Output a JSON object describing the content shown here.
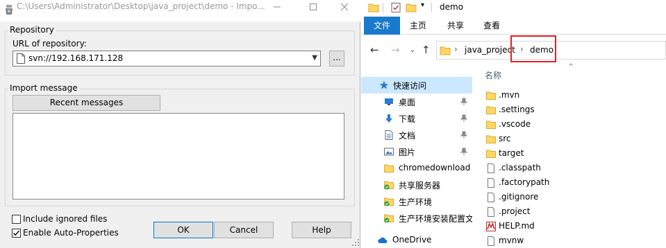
{
  "dialog": {
    "title": "C:\\Users\\Administrator\\Desktop\\java_project\\demo - Impo...",
    "repository": {
      "group_label": "Repository",
      "url_label": "URL of repository:",
      "url_value": "svn://192.168.171.128",
      "browse_label": "..."
    },
    "import_message": {
      "group_label": "Import message",
      "recent_label": "Recent messages"
    },
    "options": {
      "include_ignored": {
        "label": "Include ignored files",
        "checked": false
      },
      "auto_properties": {
        "label": "Enable Auto-Properties",
        "checked": true
      }
    },
    "buttons": {
      "ok": "OK",
      "cancel": "Cancel",
      "help": "Help"
    }
  },
  "explorer": {
    "title": "demo",
    "ribbon": {
      "file": "文件",
      "home": "主页",
      "share": "共享",
      "view": "查看"
    },
    "address": {
      "segments": [
        "java_project",
        "demo"
      ]
    },
    "nav": {
      "quick_access": "快速访问",
      "items": [
        {
          "label": "桌面",
          "pinned": true
        },
        {
          "label": "下载",
          "pinned": true
        },
        {
          "label": "文档",
          "pinned": true
        },
        {
          "label": "图片",
          "pinned": true
        },
        {
          "label": "chromedownload",
          "pinned": false
        },
        {
          "label": "共享服务器",
          "pinned": false
        },
        {
          "label": "生产环境",
          "pinned": false
        },
        {
          "label": "生产环境安装配置文",
          "pinned": false
        }
      ],
      "onedrive": "OneDrive"
    },
    "files": {
      "column_name": "名称",
      "items": [
        {
          "name": ".mvn",
          "type": "folder"
        },
        {
          "name": ".settings",
          "type": "folder"
        },
        {
          "name": ".vscode",
          "type": "folder"
        },
        {
          "name": "src",
          "type": "folder"
        },
        {
          "name": "target",
          "type": "folder"
        },
        {
          "name": ".classpath",
          "type": "file"
        },
        {
          "name": ".factorypath",
          "type": "file"
        },
        {
          "name": ".gitignore",
          "type": "file"
        },
        {
          "name": ".project",
          "type": "file"
        },
        {
          "name": "HELP.md",
          "type": "markdown"
        },
        {
          "name": "mvnw",
          "type": "file"
        }
      ]
    }
  },
  "colors": {
    "accent": "#1979ca",
    "selection": "#cce8ff",
    "highlight_box": "#e02020",
    "folder": "#ffd764"
  }
}
